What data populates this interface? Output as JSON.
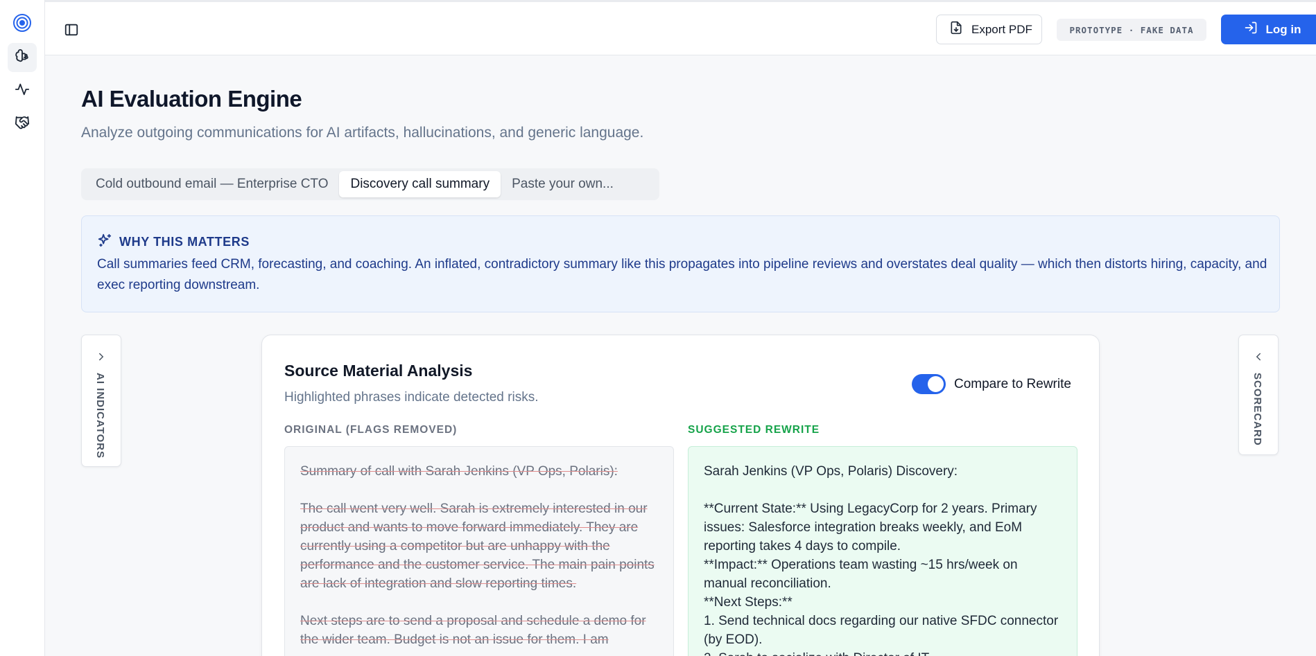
{
  "rail": {
    "items": [
      {
        "name": "brain-icon",
        "active": true
      },
      {
        "name": "activity-icon",
        "active": false
      },
      {
        "name": "handshake-icon",
        "active": false
      }
    ]
  },
  "topbar": {
    "export_label": "Export PDF",
    "prototype_badge": "PROTOTYPE · FAKE DATA",
    "login_label": "Log in"
  },
  "page": {
    "title": "AI Evaluation Engine",
    "subtitle": "Analyze outgoing communications for AI artifacts, hallucinations, and generic language."
  },
  "tabs": [
    {
      "label": "Cold outbound email — Enterprise CTO",
      "active": false
    },
    {
      "label": "Discovery call summary",
      "active": true
    },
    {
      "label": "Paste your own...",
      "active": false
    }
  ],
  "why": {
    "title": "WHY THIS MATTERS",
    "body": "Call summaries feed CRM, forecasting, and coaching. An inflated, contradictory summary like this propagates into pipeline reviews and overstates deal quality — which then distorts hiring, capacity, and exec reporting downstream."
  },
  "side_tabs": {
    "left": "AI INDICATORS",
    "right": "SCORECARD"
  },
  "analysis": {
    "title": "Source Material Analysis",
    "subtitle": "Highlighted phrases indicate detected risks.",
    "toggle_label": "Compare to Rewrite",
    "toggle_on": true,
    "original_label": "ORIGINAL (FLAGS REMOVED)",
    "rewrite_label": "SUGGESTED REWRITE",
    "original_paragraphs": [
      "Summary of call with Sarah Jenkins (VP Ops, Polaris):",
      "The call went very well. Sarah is extremely interested in our product and wants to move forward immediately. They are currently using a competitor but are unhappy with the performance and the customer service. The main pain points are lack of integration and slow reporting times.",
      "Next steps are to send a proposal and schedule a demo for the wider team. Budget is not an issue for them. I am"
    ],
    "rewrite_text": "Sarah Jenkins (VP Ops, Polaris) Discovery:\n\n**Current State:** Using LegacyCorp for 2 years. Primary issues: Salesforce integration breaks weekly, and EoM reporting takes 4 days to compile.\n**Impact:** Operations team wasting ~15 hrs/week on manual reconciliation.\n**Next Steps:**\n1. Send technical docs regarding our native SFDC connector (by EOD).\n2. Sarah to socialize with Director of IT."
  },
  "colors": {
    "accent": "#2563eb",
    "why_bg": "#eef4fd",
    "why_text": "#1e3a8a",
    "rewrite_label": "#16a34a",
    "rewrite_bg": "#ebfbf2"
  }
}
